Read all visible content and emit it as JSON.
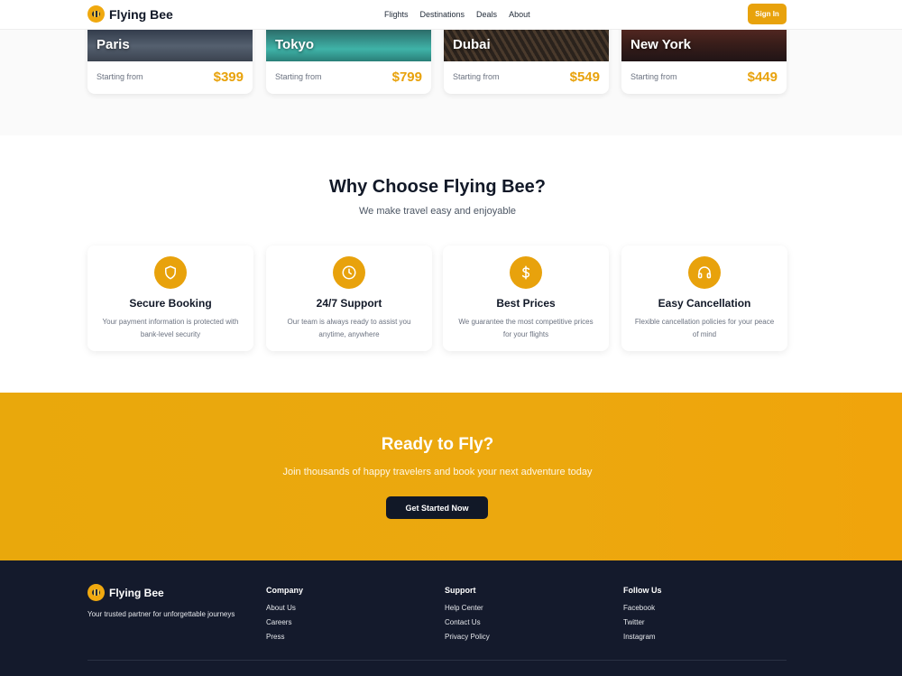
{
  "header": {
    "brand": "Flying Bee",
    "nav": [
      "Flights",
      "Destinations",
      "Deals",
      "About"
    ],
    "signin_label": "Sign In"
  },
  "destinations": [
    {
      "city": "Paris",
      "from_label": "Starting from",
      "price": "$399"
    },
    {
      "city": "Tokyo",
      "from_label": "Starting from",
      "price": "$799"
    },
    {
      "city": "Dubai",
      "from_label": "Starting from",
      "price": "$549"
    },
    {
      "city": "New York",
      "from_label": "Starting from",
      "price": "$449"
    }
  ],
  "why": {
    "title": "Why Choose Flying Bee?",
    "subtitle": "We make travel easy and enjoyable",
    "features": [
      {
        "icon": "shield-icon",
        "title": "Secure Booking",
        "desc": "Your payment information is protected with bank-level security"
      },
      {
        "icon": "clock-icon",
        "title": "24/7 Support",
        "desc": "Our team is always ready to assist you anytime, anywhere"
      },
      {
        "icon": "dollar-icon",
        "title": "Best Prices",
        "desc": "We guarantee the most competitive prices for your flights"
      },
      {
        "icon": "headphones-icon",
        "title": "Easy Cancellation",
        "desc": "Flexible cancellation policies for your peace of mind"
      }
    ]
  },
  "cta": {
    "title": "Ready to Fly?",
    "subtitle": "Join thousands of happy travelers and book your next adventure today",
    "button_label": "Get Started Now"
  },
  "footer": {
    "brand": "Flying Bee",
    "tagline": "Your trusted partner for unforgettable journeys",
    "columns": [
      {
        "heading": "Company",
        "links": [
          "About Us",
          "Careers",
          "Press"
        ]
      },
      {
        "heading": "Support",
        "links": [
          "Help Center",
          "Contact Us",
          "Privacy Policy"
        ]
      },
      {
        "heading": "Follow Us",
        "links": [
          "Facebook",
          "Twitter",
          "Instagram"
        ]
      }
    ]
  },
  "colors": {
    "accent": "#e8a20c",
    "dark": "#141a2c",
    "cta_button": "#111827"
  }
}
